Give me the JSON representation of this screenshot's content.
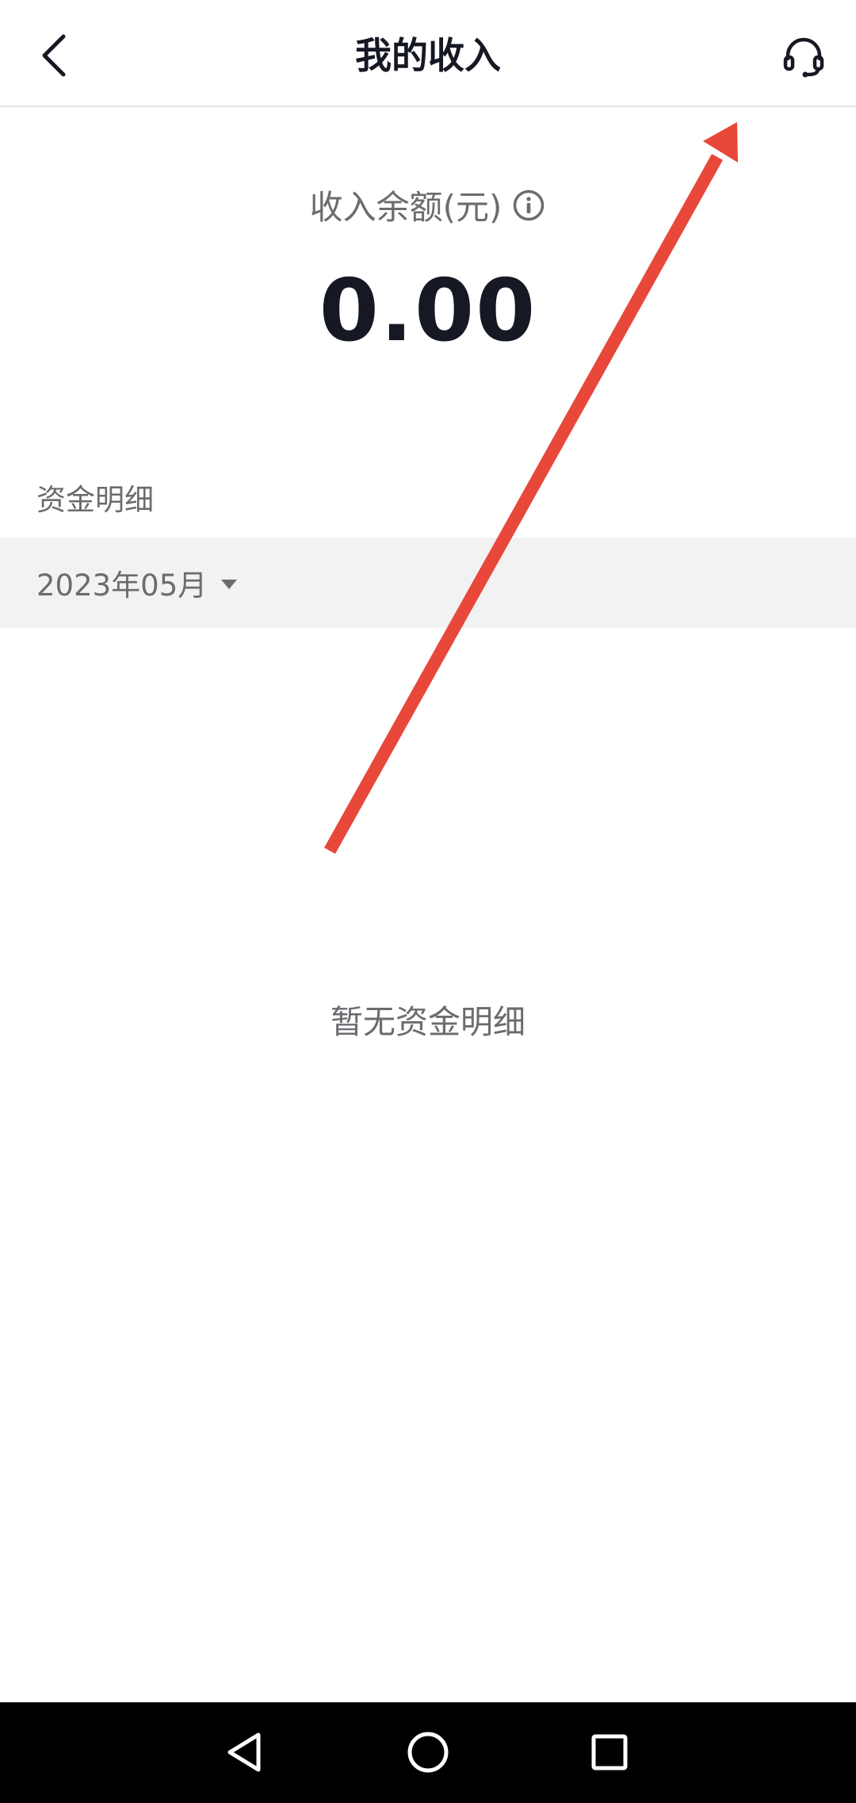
{
  "header": {
    "title": "我的收入"
  },
  "balance": {
    "label": "收入余额(元)",
    "value": "0.00"
  },
  "details": {
    "section_title": "资金明细",
    "month": "2023年05月",
    "empty_text": "暂无资金明细"
  },
  "icons": {
    "back": "chevron-left-icon",
    "service": "headset-icon",
    "info": "info-icon",
    "dropdown": "caret-down-icon",
    "nav_back": "triangle-back-icon",
    "nav_home": "circle-home-icon",
    "nav_recents": "square-recents-icon"
  },
  "colors": {
    "text_primary": "#161823",
    "text_secondary": "#6b6b70",
    "month_bar_bg": "#f2f2f2",
    "annotation_arrow": "#e8483a",
    "navbar_bg": "#000000"
  }
}
